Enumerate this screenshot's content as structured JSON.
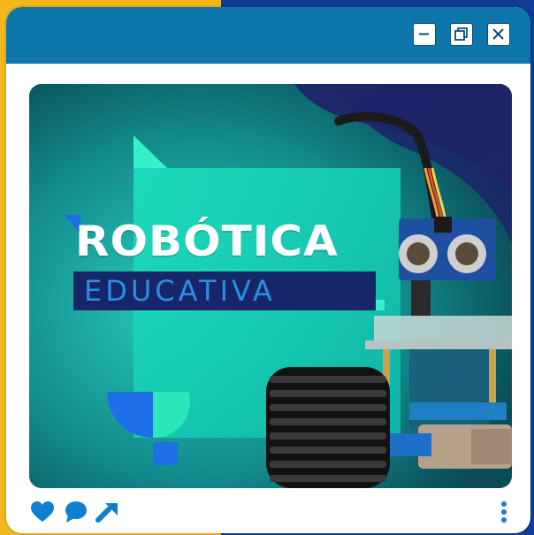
{
  "window": {
    "buttons": {
      "minimize_icon": "minimize-icon",
      "maximize_icon": "restore-icon",
      "close_icon": "close-icon"
    }
  },
  "post": {
    "image": {
      "title": "ROBÓTICA",
      "subtitle": "EDUCATIVA"
    },
    "actions": {
      "like_icon": "heart-icon",
      "comment_icon": "chat-bubble-icon",
      "share_icon": "share-arrow-icon",
      "more_icon": "vertical-dots-icon"
    }
  },
  "colors": {
    "background_left": "#f3b71c",
    "background_right": "#0e3c96",
    "titlebar": "#0d76aa",
    "image_teal": "#17d5b5",
    "title_bar_navy": "#162668",
    "subtitle_blue": "#2b8fe0",
    "action_icons": "#0f7fd0"
  }
}
